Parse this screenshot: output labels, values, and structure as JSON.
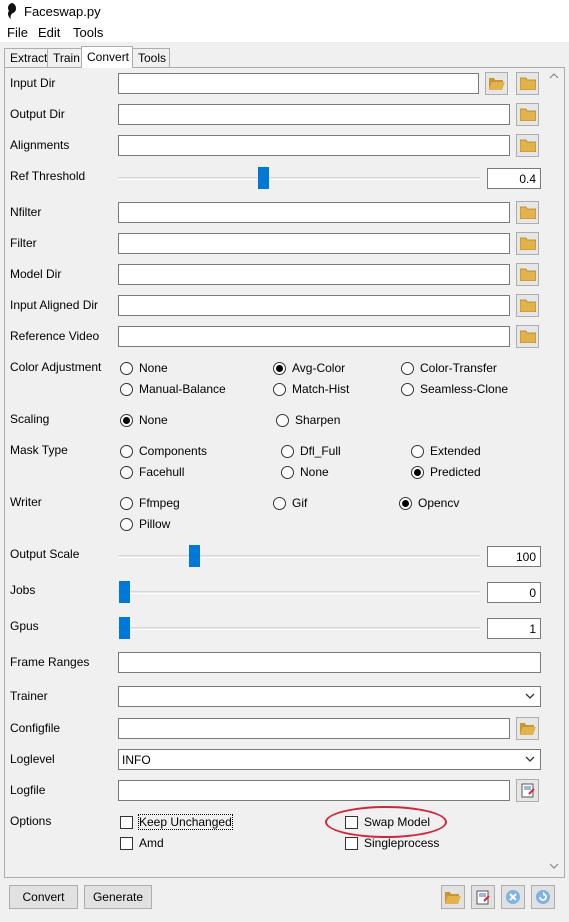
{
  "window": {
    "title": "Faceswap.py"
  },
  "menu": [
    "File",
    "Edit",
    "Tools"
  ],
  "tabs": [
    "Extract",
    "Train",
    "Convert",
    "Tools"
  ],
  "active_tab": "Convert",
  "fields": {
    "input_dir": "Input Dir",
    "output_dir": "Output Dir",
    "alignments": "Alignments",
    "ref_threshold": "Ref Threshold",
    "nfilter": "Nfilter",
    "filter": "Filter",
    "model_dir": "Model Dir",
    "input_aligned_dir": "Input Aligned Dir",
    "reference_video": "Reference Video",
    "color_adjustment": "Color Adjustment",
    "scaling": "Scaling",
    "mask_type": "Mask Type",
    "writer": "Writer",
    "output_scale": "Output Scale",
    "jobs": "Jobs",
    "gpus": "Gpus",
    "frame_ranges": "Frame Ranges",
    "trainer": "Trainer",
    "configfile": "Configfile",
    "loglevel": "Loglevel",
    "logfile": "Logfile",
    "options": "Options"
  },
  "sliders": {
    "ref_threshold": {
      "value": "0.4",
      "fraction": 0.4
    },
    "output_scale": {
      "value": "100",
      "fraction": 0.2
    },
    "jobs": {
      "value": "0",
      "fraction": 0.0
    },
    "gpus": {
      "value": "1",
      "fraction": 0.0
    }
  },
  "color_adjustment": [
    "None",
    "Avg-Color",
    "Color-Transfer",
    "Manual-Balance",
    "Match-Hist",
    "Seamless-Clone"
  ],
  "color_adjustment_selected": "Avg-Color",
  "scaling": [
    "None",
    "Sharpen"
  ],
  "scaling_selected": "None",
  "mask_type": [
    "Components",
    "Dfl_Full",
    "Extended",
    "Facehull",
    "None",
    "Predicted"
  ],
  "mask_type_selected": "Predicted",
  "writer": [
    "Ffmpeg",
    "Gif",
    "Opencv",
    "Pillow"
  ],
  "writer_selected": "Opencv",
  "trainer_value": "",
  "loglevel_value": "INFO",
  "options": [
    "Keep Unchanged",
    "Swap Model",
    "Amd",
    "Singleprocess"
  ],
  "buttons": {
    "convert": "Convert",
    "generate": "Generate"
  },
  "icons": {
    "logo": "faceswap-logo-icon",
    "folder": "folder-open-icon",
    "save": "save-file-icon",
    "clear": "clear-icon",
    "reset": "reset-icon"
  },
  "colors": {
    "accent": "#0078d7",
    "highlight": "#d0273a",
    "folder": "#e3b34b"
  }
}
